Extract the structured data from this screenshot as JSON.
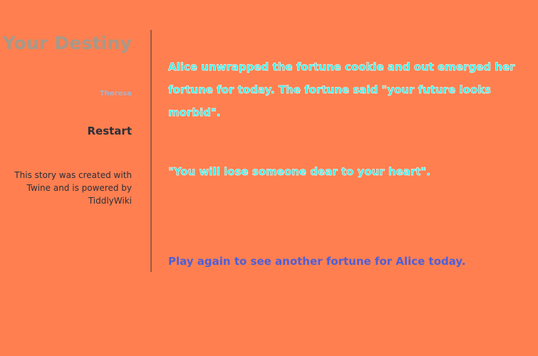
{
  "sidebar": {
    "title": "Your Destiny",
    "author": "Theresa",
    "restart_label": "Restart",
    "credits": "This story was created with Twine and is powered by TiddlyWiki"
  },
  "passage": {
    "paragraph1": "Alice unwrapped the fortune cookie and out emerged her fortune for today. The fortune said \"your future looks morbid\".",
    "paragraph2": "\"You will lose someone dear to your heart\".",
    "play_again_link": "Play again to see another fortune for Alice today."
  },
  "colors": {
    "background": "#ff7f50",
    "passage_text": "#38efe6",
    "link": "#4f5fd6",
    "title": "#a6998a"
  }
}
